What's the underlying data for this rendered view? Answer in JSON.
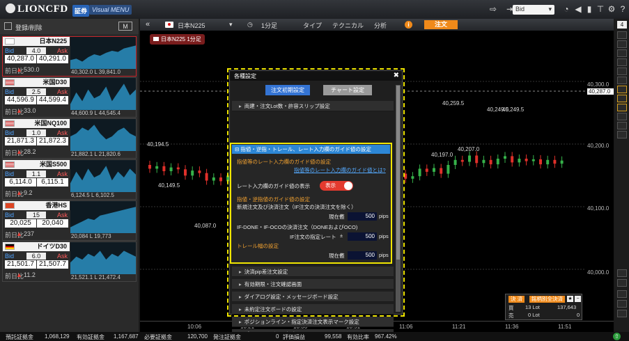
{
  "header": {
    "logo": "LIONCFD",
    "tag_securities": "証券",
    "tag_visual": "Visual MENU",
    "bid_select": "Bid"
  },
  "left": {
    "register_label": "登録/削除",
    "mode_btn": "M"
  },
  "rates": [
    {
      "name": "日本N225",
      "spread": "4.0",
      "bid": "40,287.0",
      "ask": "40,291.0",
      "prev": "530.0",
      "hi": "40,302.0",
      "lo": "L 39,841.0",
      "bid_label": "Bid",
      "ask_label": "Ask",
      "prev_label": "前日比",
      "flag": "jp",
      "up_series": [
        0.3,
        0.35,
        0.25,
        0.4,
        0.5,
        0.45,
        0.55,
        0.62,
        0.58,
        0.7,
        0.75,
        0.8
      ]
    },
    {
      "name": "米国D30",
      "spread": "2.5",
      "bid": "44,596.9",
      "ask": "44,599.4",
      "prev": "33.0",
      "hi": "44,600.9",
      "lo": "L 44,545.4",
      "bid_label": "Bid",
      "ask_label": "Ask",
      "prev_label": "前日比",
      "flag": "us",
      "up_series": [
        0.2,
        0.6,
        0.3,
        0.7,
        0.4,
        0.5,
        0.8,
        0.3,
        0.6,
        0.9,
        0.5,
        0.7
      ]
    },
    {
      "name": "米国NQ100",
      "spread": "1.0",
      "bid": "21,871.3",
      "ask": "21,872.3",
      "prev": "28.2",
      "hi": "21,882.1",
      "lo": "L 21,820.6",
      "bid_label": "Bid",
      "ask_label": "Ask",
      "prev_label": "前日比",
      "flag": "us",
      "up_series": [
        0.5,
        0.6,
        0.8,
        0.7,
        0.9,
        0.6,
        0.4,
        0.5,
        0.7,
        0.8,
        0.6,
        0.5
      ]
    },
    {
      "name": "米国S500",
      "spread": "1.1",
      "bid": "6,114.0",
      "ask": "6,115.1",
      "prev": "9.2",
      "hi": "6,124.5",
      "lo": "L 6,102.5",
      "bid_label": "Bid",
      "ask_label": "Ask",
      "prev_label": "前日比",
      "flag": "us",
      "up_series": [
        0.3,
        0.7,
        0.4,
        0.8,
        0.5,
        0.6,
        0.9,
        0.4,
        0.7,
        0.5,
        0.8,
        0.6
      ]
    },
    {
      "name": "香港HS",
      "spread": "15",
      "bid": "20,025",
      "ask": "20,040",
      "prev": "237",
      "hi": "20,084",
      "lo": "L 19,773",
      "bid_label": "Bid",
      "ask_label": "Ask",
      "prev_label": "前日比",
      "flag": "hk",
      "up_series": [
        0.2,
        0.3,
        0.4,
        0.5,
        0.45,
        0.6,
        0.65,
        0.7,
        0.75,
        0.8,
        0.85,
        0.9
      ]
    },
    {
      "name": "ドイツD30",
      "spread": "6.0",
      "bid": "21,501.7",
      "ask": "21,507.7",
      "prev": "11.2",
      "hi": "21,521.1",
      "lo": "L 21,472.4",
      "bid_label": "Bid",
      "ask_label": "Ask",
      "prev_label": "前日比",
      "flag": "de",
      "up_series": [
        0.4,
        0.6,
        0.5,
        0.7,
        0.6,
        0.8,
        0.5,
        0.7,
        0.6,
        0.8,
        0.7,
        0.6
      ]
    }
  ],
  "chart_toolbar": {
    "symbol": "日本N225",
    "interval": "1分足",
    "type": "タイプ",
    "technical": "テクニカル",
    "analysis": "分析",
    "order": "注文",
    "symbol_tag": "日本N225 1分足"
  },
  "chart_labels": {
    "p1": "40,194.5",
    "p2": "40,149.5",
    "p3": "40,087.0",
    "p4": "40,259.5",
    "p5": "40,197.0",
    "p6": "40,207.0",
    "p7": "40,249.5",
    "p8": "40,249.5",
    "y1": "40,300.0",
    "y2": "40,287.0",
    "y3": "40,200.0",
    "y4": "40,100.0",
    "y5": "40,000.0"
  },
  "times": [
    "10:06",
    "10:21",
    "10:36",
    "10:51",
    "11:06",
    "11:21",
    "11:36",
    "11:51"
  ],
  "dialog": {
    "title": "各種設定",
    "tab_order": "注文初期設定",
    "tab_chart": "チャート設定",
    "acc_top": "両建・注文Lot数・許容スリップ設定",
    "open_header": "指値・逆指・トレール、レート入力欄のガイド値の設定",
    "guide_hdr": "指値等のレート入力欄のガイド値の設定",
    "guide_link": "指値等のレート入力欄のガイド値とは?",
    "guide_show": "レート入力欄のガイド値の表示",
    "toggle": "表示",
    "limit_hdr": "指値・逆指値のガイド値の設定",
    "new_settle": "新規注文及び決済注文（IF注文の決済注文を除く）",
    "cur_value": "現在値",
    "pm": "±",
    "pip1": "500",
    "pips": "pips",
    "ifdone": "IF-DONE・IF-OCOの決済注文（DONEおよびOCO)",
    "if_rate": "IF注文の指定レート",
    "pip2": "500",
    "trail_hdr": "トレール幅の設定",
    "cur_value2": "現在値",
    "pip3": "500",
    "items": [
      "決済pip差注文設定",
      "有効期限・注文確認画面",
      "ダイアログ設定・メッセージボード設定",
      "未約定注文ボードの設定",
      "ポジションライン・指定決済注文表示マーク設定",
      "ポジションボード設定"
    ]
  },
  "pos": {
    "settle": "決 済",
    "by_symbol": "銘柄別全決済",
    "buy": "買",
    "sell": "売",
    "buy_lot": "13 Lot",
    "sell_lot": "0 Lot",
    "buy_val": "137,643",
    "sell_val": "0"
  },
  "bottom": {
    "l1": "預託証拠金",
    "v1": "1,068,129",
    "l2": "有効証拠金",
    "v2": "1,167,687",
    "l3": "必要証拠金",
    "v3": "120,700",
    "l4": "発注証拠金",
    "v4": "0",
    "l5": "評価損益",
    "v5": "99,558",
    "l6": "有効比率",
    "v6": "967.42%"
  },
  "rail": {
    "top": "4"
  }
}
